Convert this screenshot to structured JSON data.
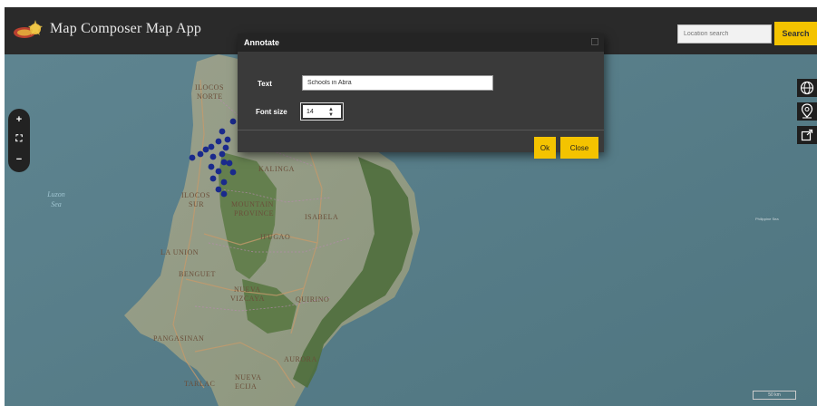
{
  "header": {
    "title": "Map Composer Map App",
    "search_placeholder": "Location search",
    "search_button": "Search"
  },
  "zoom": {
    "zoom_in": "+",
    "fullscreen": "⛶",
    "zoom_out": "−"
  },
  "tools": {
    "globe": "globe-icon",
    "pin": "map-pin-icon",
    "export": "export-icon"
  },
  "dialog": {
    "title": "Annotate",
    "text_label": "Text",
    "text_value": "Schools in Abra",
    "font_size_label": "Font size",
    "font_size_value": "14",
    "ok": "Ok",
    "close": "Close"
  },
  "map": {
    "labels": {
      "ilocos_norte_1": "ILOCOS",
      "ilocos_norte_2": "NORTE",
      "ilocos_sur_1": "ILOCOS",
      "ilocos_sur_2": "SUR",
      "kalinga": "KALINGA",
      "mountain_province_1": "MOUNTAIN",
      "mountain_province_2": "PROVINCE",
      "ifugao": "IFUGAO",
      "isabela": "ISABELA",
      "la_union": "LA UNION",
      "benguet": "BENGUET",
      "nueva_vizcaya_1": "NUEVA",
      "nueva_vizcaya_2": "VIZCAYA",
      "quirino": "QUIRINO",
      "pangasinan": "PANGASINAN",
      "aurora": "AURORA",
      "tarlac": "TARLAC",
      "nueva_ecija_1": "NUEVA",
      "nueva_ecija_2": "ECIJA"
    },
    "luzon_sea_1": "Luzon",
    "luzon_sea_2": "Sea",
    "philippine_sea": "Philippine Sea",
    "scale": "50 km"
  },
  "colors": {
    "accent": "#f4c300",
    "header_bg": "#2a2a2a",
    "dialog_bg": "#3a3a3a",
    "marker": "#1a2a8c"
  }
}
